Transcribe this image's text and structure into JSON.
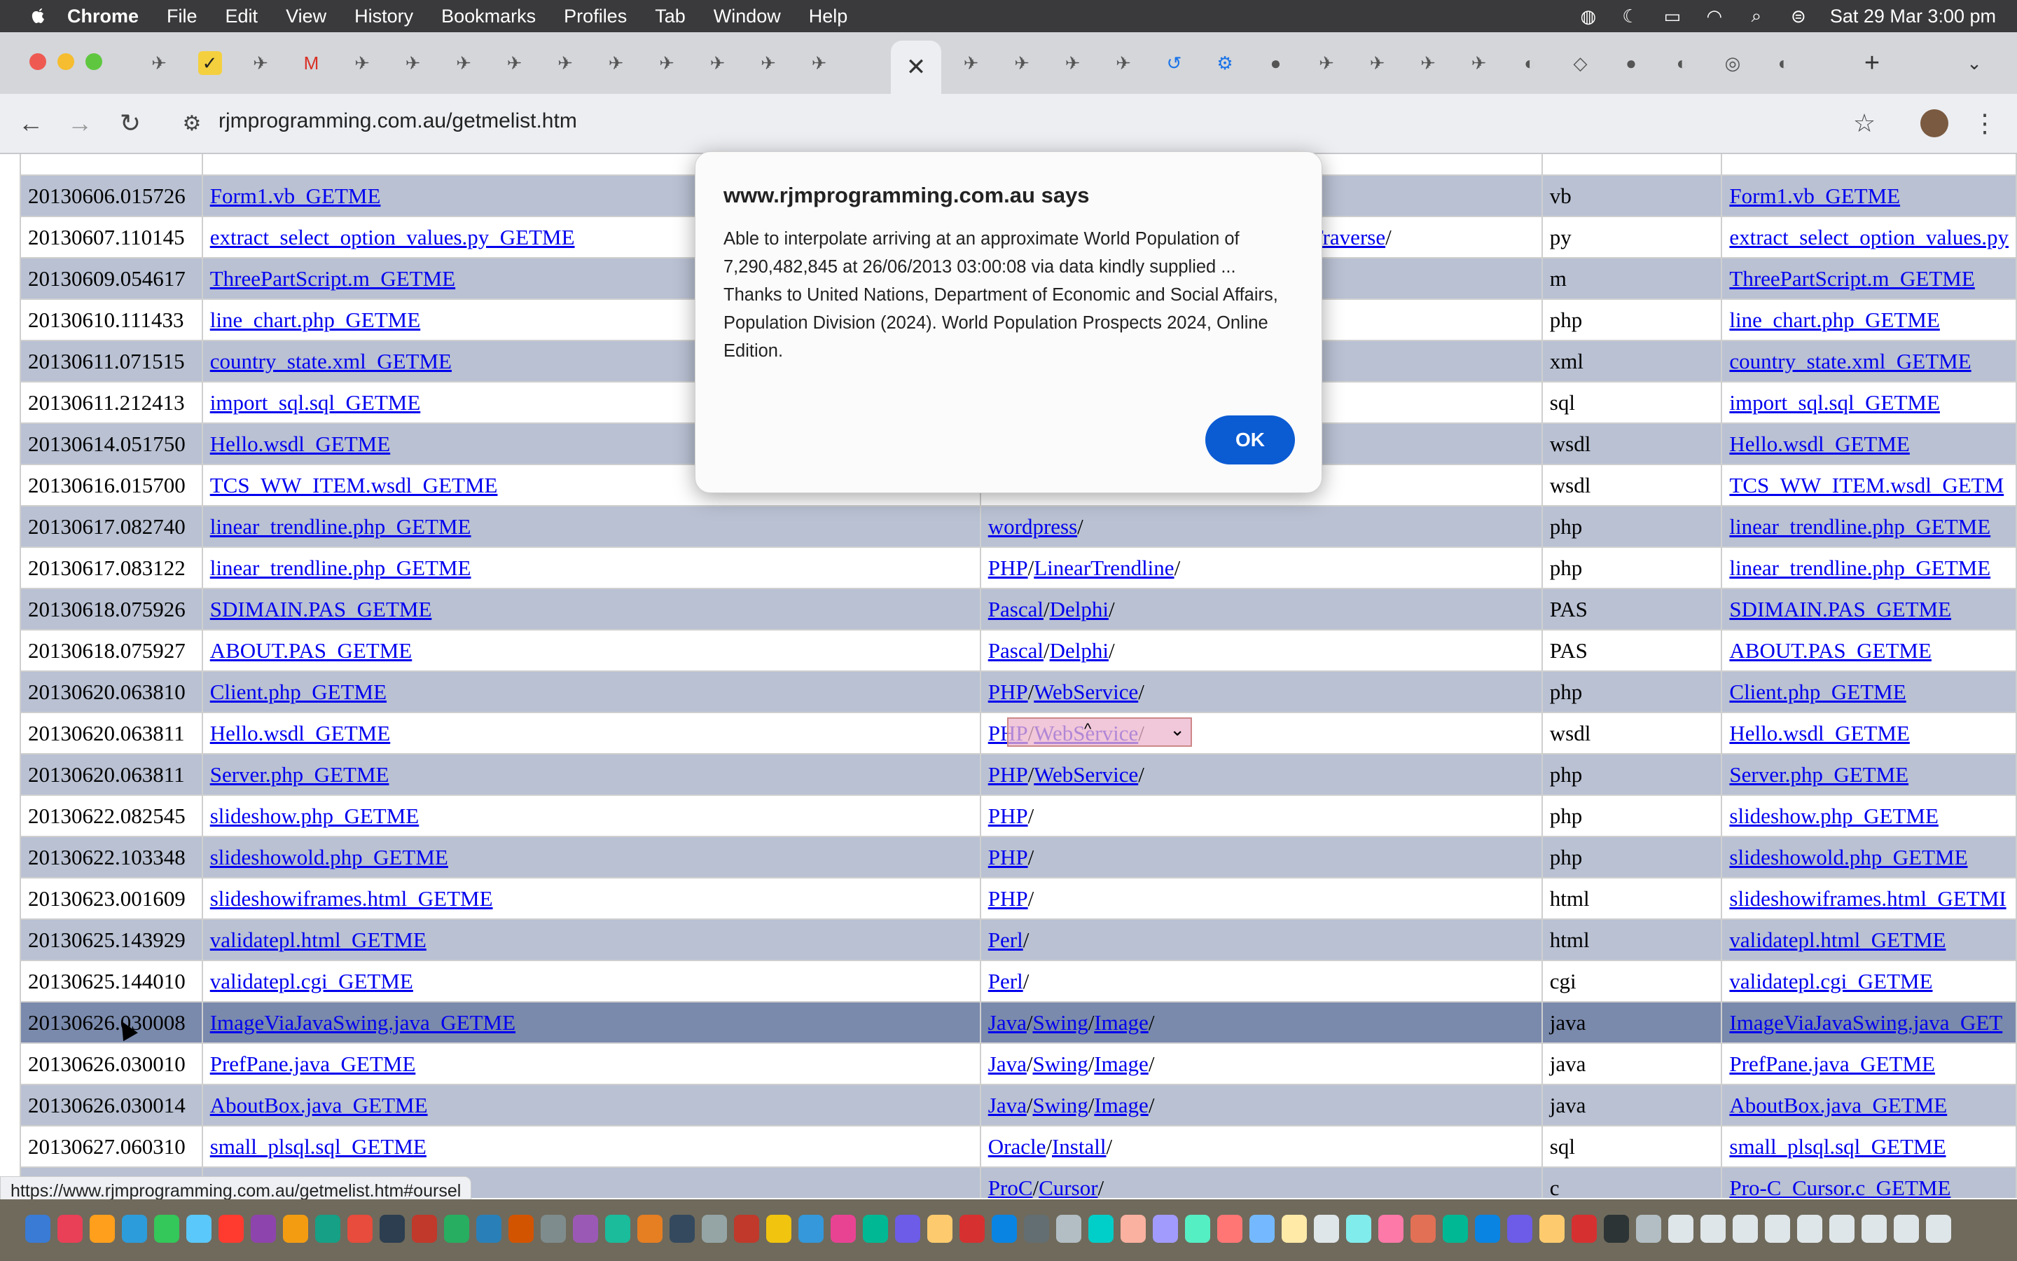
{
  "menubar": {
    "app": "Chrome",
    "items": [
      "File",
      "Edit",
      "View",
      "History",
      "Bookmarks",
      "Profiles",
      "Tab",
      "Window",
      "Help"
    ],
    "clock": "Sat 29 Mar  3:00 pm"
  },
  "toolbar": {
    "url": "rjmprogramming.com.au/getmelist.htm"
  },
  "dialog": {
    "title": "www.rjmprogramming.com.au says",
    "message": "Able to interpolate arriving at an approximate World Population of 7,290,482,845 at 26/06/2013 03:00:08 via data kindly supplied ... Thanks to United Nations, Department of Economic and Social Affairs, Population Division (2024). World Population Prospects 2024, Online Edition.",
    "ok": "OK"
  },
  "status_url": "https://www.rjmprogramming.com.au/getmelist.htm#oursel",
  "rows": [
    {
      "ts": "20130606.015726",
      "file": "Form1.vb_GETME",
      "path": [],
      "ext": "vb",
      "link": "Form1.vb_GETME"
    },
    {
      "ts": "20130607.110145",
      "file": "extract_select_option_values.py_GETME",
      "path": [
        "Traverse"
      ],
      "ext": "py",
      "link": "extract_select_option_values.py"
    },
    {
      "ts": "20130609.054617",
      "file": "ThreePartScript.m_GETME",
      "path": [],
      "ext": "m",
      "link": "ThreePartScript.m_GETME"
    },
    {
      "ts": "20130610.111433",
      "file": "line_chart.php_GETME",
      "path": [],
      "ext": "php",
      "link": "line_chart.php_GETME"
    },
    {
      "ts": "20130611.071515",
      "file": "country_state.xml_GETME",
      "path": [],
      "ext": "xml",
      "link": "country_state.xml_GETME"
    },
    {
      "ts": "20130611.212413",
      "file": "import_sql.sql_GETME",
      "path": [],
      "ext": "sql",
      "link": "import_sql.sql_GETME"
    },
    {
      "ts": "20130614.051750",
      "file": "Hello.wsdl_GETME",
      "path": [],
      "ext": "wsdl",
      "link": "Hello.wsdl_GETME"
    },
    {
      "ts": "20130616.015700",
      "file": "TCS_WW_ITEM.wsdl_GETME",
      "path": [],
      "ext": "wsdl",
      "link": "TCS_WW_ITEM.wsdl_GETM"
    },
    {
      "ts": "20130617.082740",
      "file": "linear_trendline.php_GETME",
      "path": [
        "wordpress"
      ],
      "ext": "php",
      "link": "linear_trendline.php_GETME"
    },
    {
      "ts": "20130617.083122",
      "file": "linear_trendline.php_GETME",
      "path": [
        "PHP",
        "LinearTrendline"
      ],
      "ext": "php",
      "link": "linear_trendline.php_GETME"
    },
    {
      "ts": "20130618.075926",
      "file": "SDIMAIN.PAS_GETME",
      "path": [
        "Pascal",
        "Delphi"
      ],
      "ext": "PAS",
      "link": "SDIMAIN.PAS_GETME"
    },
    {
      "ts": "20130618.075927",
      "file": "ABOUT.PAS_GETME",
      "path": [
        "Pascal",
        "Delphi"
      ],
      "ext": "PAS",
      "link": "ABOUT.PAS_GETME"
    },
    {
      "ts": "20130620.063810",
      "file": "Client.php_GETME",
      "path": [
        "PHP",
        "WebService"
      ],
      "ext": "php",
      "link": "Client.php_GETME"
    },
    {
      "ts": "20130620.063811",
      "file": "Hello.wsdl_GETME",
      "path": [
        "PHP",
        "WebService"
      ],
      "ext": "wsdl",
      "link": "Hello.wsdl_GETME"
    },
    {
      "ts": "20130620.063811",
      "file": "Server.php_GETME",
      "path": [
        "PHP",
        "WebService"
      ],
      "ext": "php",
      "link": "Server.php_GETME"
    },
    {
      "ts": "20130622.082545",
      "file": "slideshow.php_GETME",
      "path": [
        "PHP"
      ],
      "ext": "php",
      "link": "slideshow.php_GETME"
    },
    {
      "ts": "20130622.103348",
      "file": "slideshowold.php_GETME",
      "path": [
        "PHP"
      ],
      "ext": "php",
      "link": "slideshowold.php_GETME"
    },
    {
      "ts": "20130623.001609",
      "file": "slideshowiframes.html_GETME",
      "path": [
        "PHP"
      ],
      "ext": "html",
      "link": "slideshowiframes.html_GETMI"
    },
    {
      "ts": "20130625.143929",
      "file": "validatepl.html_GETME",
      "path": [
        "Perl"
      ],
      "ext": "html",
      "link": "validatepl.html_GETME"
    },
    {
      "ts": "20130625.144010",
      "file": "validatepl.cgi_GETME",
      "path": [
        "Perl"
      ],
      "ext": "cgi",
      "link": "validatepl.cgi_GETME"
    },
    {
      "ts": "20130626.030008",
      "file": "ImageViaJavaSwing.java_GETME",
      "path": [
        "Java",
        "Swing",
        "Image"
      ],
      "ext": "java",
      "link": "ImageViaJavaSwing.java_GET"
    },
    {
      "ts": "20130626.030010",
      "file": "PrefPane.java_GETME",
      "path": [
        "Java",
        "Swing",
        "Image"
      ],
      "ext": "java",
      "link": "PrefPane.java_GETME"
    },
    {
      "ts": "20130626.030014",
      "file": "AboutBox.java_GETME",
      "path": [
        "Java",
        "Swing",
        "Image"
      ],
      "ext": "java",
      "link": "AboutBox.java_GETME"
    },
    {
      "ts": "20130627.060310",
      "file": "small_plsql.sql_GETME",
      "path": [
        "Oracle",
        "Install"
      ],
      "ext": "sql",
      "link": "small_plsql.sql_GETME"
    },
    {
      "ts": "",
      "file": "",
      "path": [
        "ProC",
        "Cursor"
      ],
      "ext": "c",
      "link": "Pro-C_Cursor.c_GETME"
    }
  ],
  "highlight_row": 20,
  "colors": {
    "row_alt": "#b9c1d3",
    "row_highlight": "#7a8aac",
    "link": "#0000ee",
    "ok_button": "#0b5bd3"
  }
}
